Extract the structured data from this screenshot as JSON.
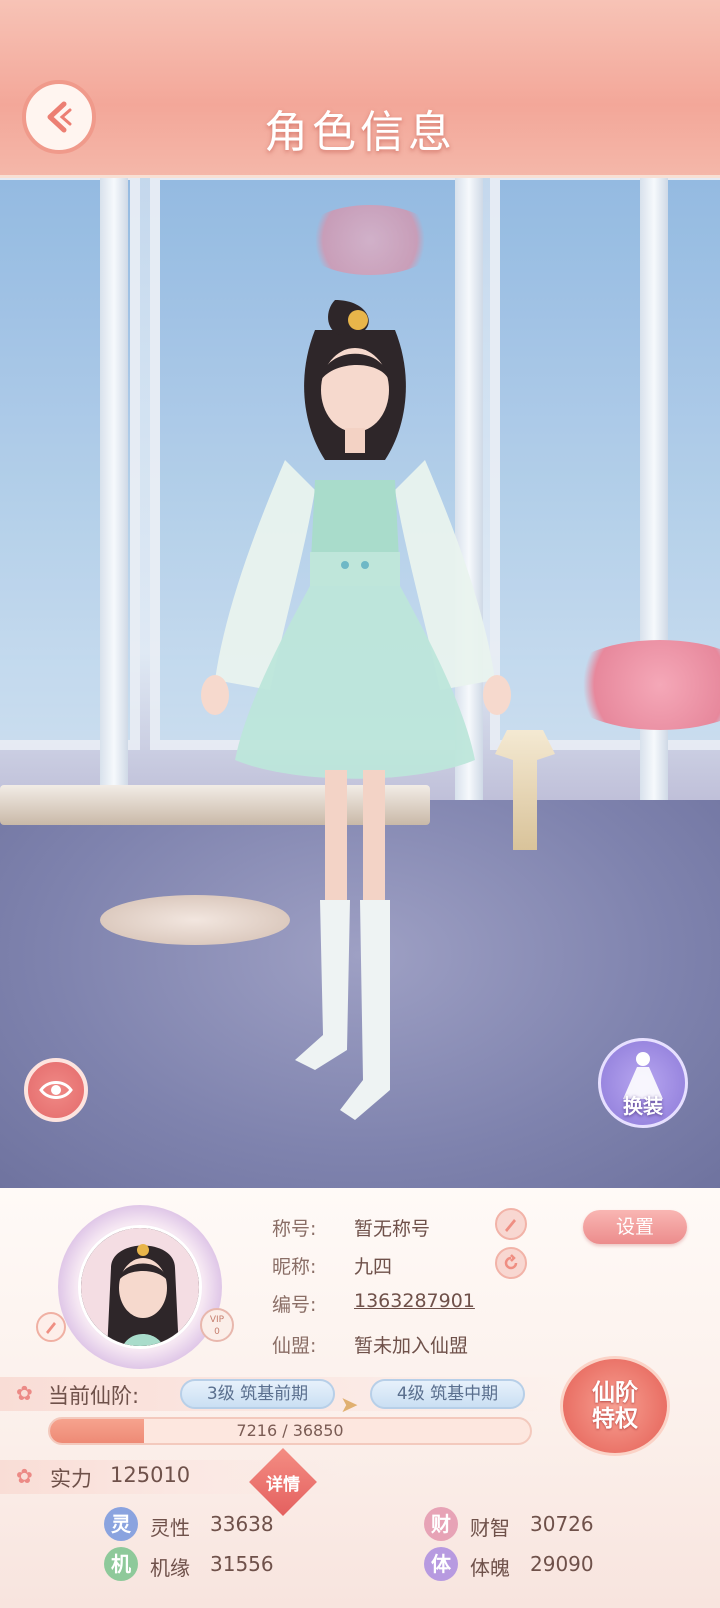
{
  "header": {
    "title": "角色信息"
  },
  "scene": {
    "outfit_label": "换装"
  },
  "profile": {
    "vip_label": "VIP",
    "vip_level": "0",
    "title_label": "称号:",
    "title_value": "暂无称号",
    "nickname_label": "昵称:",
    "nickname_value": "九四",
    "id_label": "编号:",
    "id_value": "1363287901",
    "alliance_label": "仙盟:",
    "alliance_value": "暂未加入仙盟",
    "settings_label": "设置"
  },
  "stage": {
    "label": "当前仙阶:",
    "current": "3级 筑基前期",
    "next": "4级 筑基中期",
    "progress_text": "7216 / 36850",
    "progress_fraction": 0.196,
    "privilege_line1": "仙阶",
    "privilege_line2": "特权"
  },
  "power": {
    "label": "实力",
    "value": "125010",
    "details_label": "详情"
  },
  "attributes": [
    {
      "badge": "灵",
      "name": "灵性",
      "value": "33638",
      "color": "#8aa3df"
    },
    {
      "badge": "财",
      "name": "财智",
      "value": "30726",
      "color": "#e7a3b6"
    },
    {
      "badge": "机",
      "name": "机缘",
      "value": "31556",
      "color": "#8ec99a"
    },
    {
      "badge": "体",
      "name": "体魄",
      "value": "29090",
      "color": "#b79ae0"
    }
  ]
}
